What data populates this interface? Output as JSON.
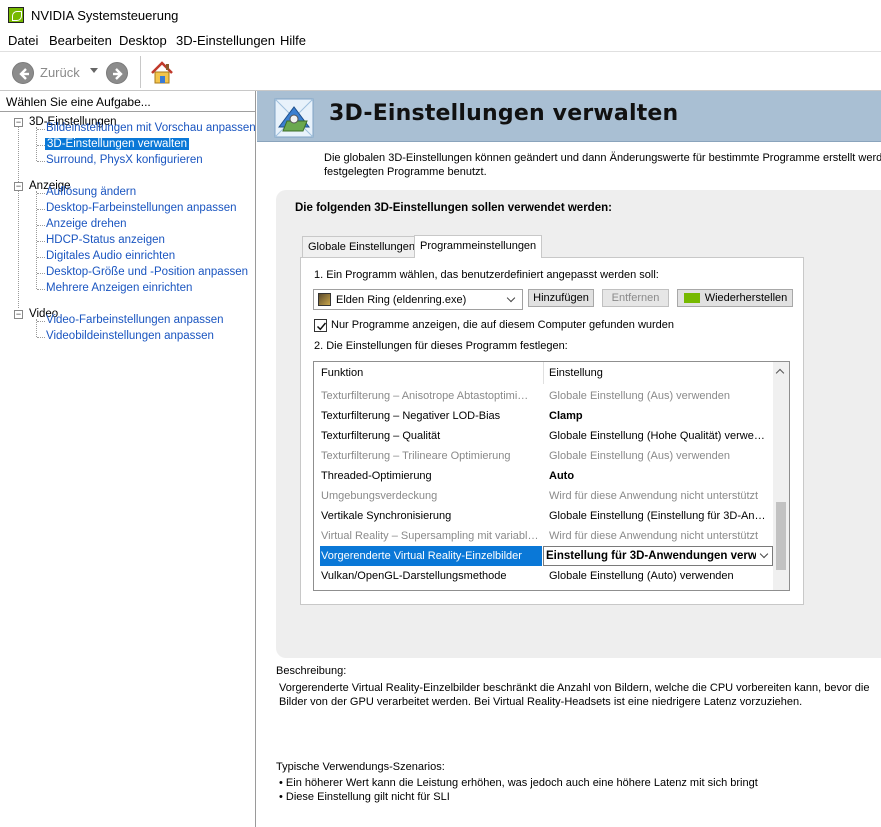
{
  "window": {
    "title": "NVIDIA Systemsteuerung"
  },
  "menu": [
    {
      "label": "Datei"
    },
    {
      "label": "Bearbeiten"
    },
    {
      "label": "Desktop"
    },
    {
      "label": "3D-Einstellungen"
    },
    {
      "label": "Hilfe"
    }
  ],
  "toolbar": {
    "back_label": "Zurück"
  },
  "sidebar": {
    "header": "Wählen Sie eine Aufgabe...",
    "categories": [
      {
        "label": "3D-Einstellungen",
        "toggle": "−",
        "items": [
          {
            "label": "Bildeinstellungen mit Vorschau anpassen"
          },
          {
            "label": "3D-Einstellungen verwalten"
          },
          {
            "label": "Surround, PhysX konfigurieren"
          }
        ]
      },
      {
        "label": "Anzeige",
        "toggle": "−",
        "items": [
          {
            "label": "Auflösung ändern"
          },
          {
            "label": "Desktop-Farbeinstellungen anpassen"
          },
          {
            "label": "Anzeige drehen"
          },
          {
            "label": "HDCP-Status anzeigen"
          },
          {
            "label": "Digitales Audio einrichten"
          },
          {
            "label": "Desktop-Größe und -Position anpassen"
          },
          {
            "label": "Mehrere Anzeigen einrichten"
          }
        ]
      },
      {
        "label": "Video",
        "toggle": "−",
        "items": [
          {
            "label": "Video-Farbeinstellungen anpassen"
          },
          {
            "label": "Videobildeinstellungen anpassen"
          }
        ]
      }
    ]
  },
  "page": {
    "title": "3D-Einstellungen verwalten",
    "intro_line1": "Die globalen 3D-Einstellungen können geändert und dann Änderungswerte für bestimmte Programme erstellt werden. D",
    "intro_line2": "festgelegten Programme benutzt.",
    "box_heading": "Die folgenden 3D-Einstellungen sollen verwendet werden:",
    "tabs": [
      {
        "label": "Globale Einstellungen"
      },
      {
        "label": "Programmeinstellungen"
      }
    ],
    "step1": "1. Ein Programm wählen, das benutzerdefiniert angepasst werden soll:",
    "program_selected": "Elden Ring (eldenring.exe)",
    "buttons": {
      "add": "Hinzufügen",
      "remove": "Entfernen",
      "restore": "Wiederherstellen"
    },
    "checkbox_label": "Nur Programme anzeigen, die auf diesem Computer gefunden wurden",
    "checkbox_checked": true,
    "step2": "2. Die Einstellungen für dieses Programm festlegen:",
    "grid": {
      "headers": {
        "function": "Funktion",
        "setting": "Einstellung"
      },
      "rows": [
        {
          "function": "Texturfilterung – Anisotrope Abtastoptimi…",
          "setting": "Globale Einstellung (Aus) verwenden",
          "grey": true
        },
        {
          "function": "Texturfilterung – Negativer LOD-Bias",
          "setting": "Clamp",
          "bold": true
        },
        {
          "function": "Texturfilterung – Qualität",
          "setting": "Globale Einstellung (Hohe Qualität) verwe…"
        },
        {
          "function": "Texturfilterung – Trilineare Optimierung",
          "setting": "Globale Einstellung (Aus) verwenden",
          "grey": true
        },
        {
          "function": "Threaded-Optimierung",
          "setting": "Auto",
          "bold": true
        },
        {
          "function": "Umgebungsverdeckung",
          "setting": "Wird für diese Anwendung nicht unterstützt",
          "grey": true
        },
        {
          "function": "Vertikale Synchronisierung",
          "setting": "Globale Einstellung (Einstellung für 3D-An…"
        },
        {
          "function": "Virtual Reality – Supersampling mit variabl…",
          "setting": "Wird für diese Anwendung nicht unterstützt",
          "grey": true
        },
        {
          "function": "Vorgerenderte Virtual Reality-Einzelbilder",
          "setting": "Einstellung für 3D-Anwendungen verw",
          "selected": true
        },
        {
          "function": "Vulkan/OpenGL-Darstellungsmethode",
          "setting": "Globale Einstellung (Auto) verwenden"
        }
      ]
    },
    "description_label": "Beschreibung:",
    "description_line1": "Vorgerenderte Virtual Reality-Einzelbilder beschränkt die Anzahl von Bildern, welche die CPU vorbereiten kann, bevor die",
    "description_line2": "Bilder von der GPU verarbeitet werden. Bei Virtual Reality-Headsets ist eine niedrigere Latenz vorzuziehen.",
    "usage_label": "Typische Verwendungs-Szenarios:",
    "usage_items": [
      "Ein höherer Wert kann die Leistung erhöhen, was jedoch auch eine höhere Latenz mit sich bringt",
      "Diese Einstellung gilt nicht für SLI"
    ]
  },
  "colors": {
    "accent_selection": "#0a78d7",
    "link_blue": "#1a55c0",
    "banner_bg": "#a9bfd3",
    "nvidia_green": "#76b900"
  }
}
